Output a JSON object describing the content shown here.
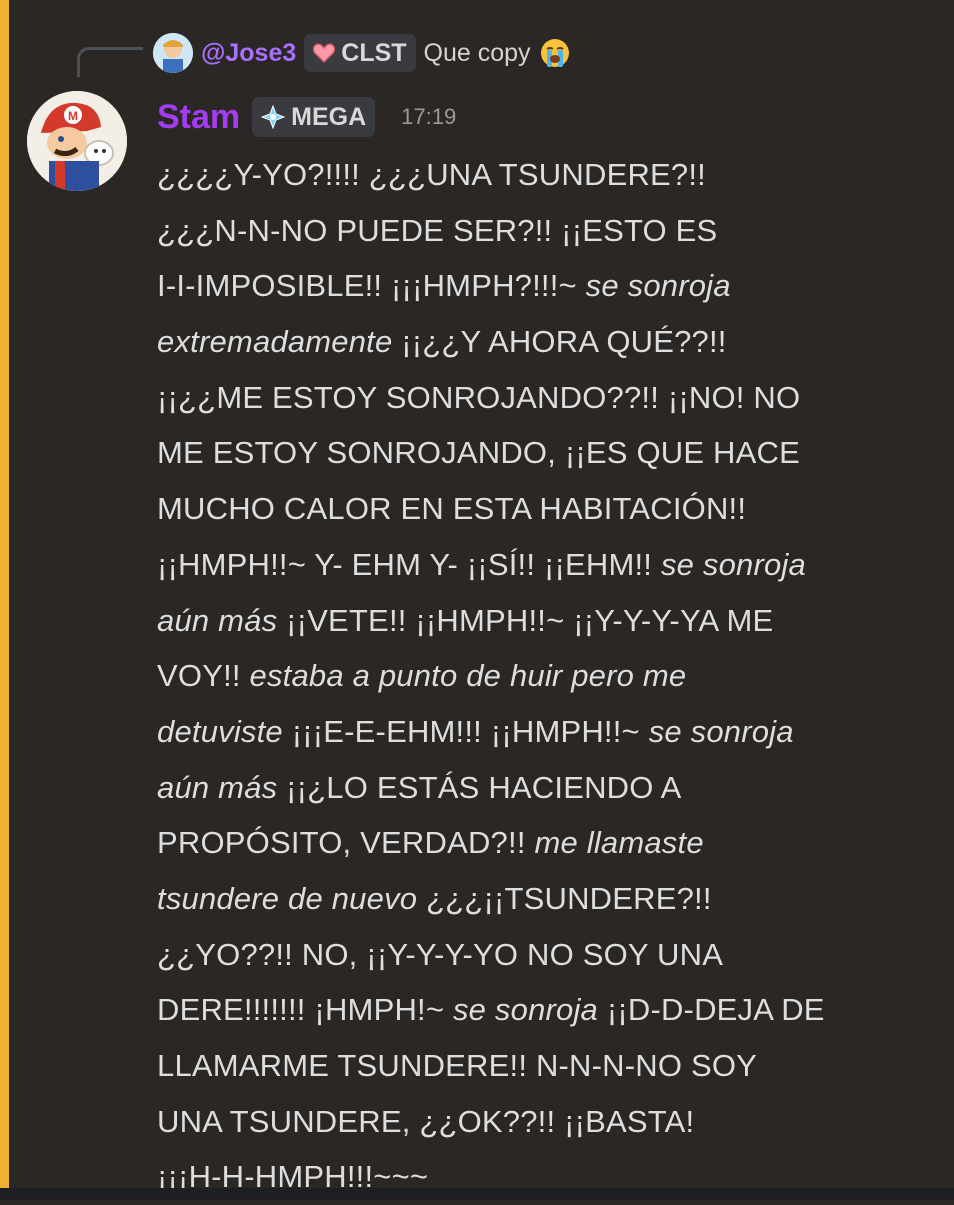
{
  "reply": {
    "username": "@Jose3",
    "tag_label": "CLST",
    "text": "Que copy",
    "emoji": "loudly-crying-face"
  },
  "message": {
    "author": "Stam",
    "role_tag": "MEGA",
    "timestamp": "17:19",
    "lines": [
      [
        {
          "t": "¿¿¿¿Y-YO?!!!! ¿¿¿UNA TSUNDERE?!!",
          "i": false
        }
      ],
      [
        {
          "t": "¿¿¿N-N-NO PUEDE SER?!! ¡¡ESTO ES",
          "i": false
        }
      ],
      [
        {
          "t": "I-I-IMPOSIBLE!! ¡¡¡HMPH?!!!~ ",
          "i": false
        },
        {
          "t": "se sonroja",
          "i": true
        }
      ],
      [
        {
          "t": "extremadamente",
          "i": true
        },
        {
          "t": " ¡¡¿¿Y AHORA QUÉ??!!",
          "i": false
        }
      ],
      [
        {
          "t": "¡¡¿¿ME ESTOY SONROJANDO??!! ¡¡NO! NO",
          "i": false
        }
      ],
      [
        {
          "t": "ME ESTOY SONROJANDO, ¡¡ES QUE HACE",
          "i": false
        }
      ],
      [
        {
          "t": "MUCHO CALOR EN ESTA HABITACIÓN!!",
          "i": false
        }
      ],
      [
        {
          "t": "¡¡HMPH!!~ Y- EHM Y- ¡¡SÍ!! ¡¡EHM!! ",
          "i": false
        },
        {
          "t": "se sonroja",
          "i": true
        }
      ],
      [
        {
          "t": "aún más",
          "i": true
        },
        {
          "t": " ¡¡VETE!! ¡¡HMPH!!~ ¡¡Y-Y-Y-YA ME",
          "i": false
        }
      ],
      [
        {
          "t": "VOY!! ",
          "i": false
        },
        {
          "t": "estaba a punto de huir pero me",
          "i": true
        }
      ],
      [
        {
          "t": "detuviste",
          "i": true
        },
        {
          "t": " ¡¡¡E-E-EHM!!! ¡¡HMPH!!~ ",
          "i": false
        },
        {
          "t": "se sonroja",
          "i": true
        }
      ],
      [
        {
          "t": "aún más",
          "i": true
        },
        {
          "t": " ¡¡¿LO ESTÁS HACIENDO A",
          "i": false
        }
      ],
      [
        {
          "t": "PROPÓSITO, VERDAD?!! ",
          "i": false
        },
        {
          "t": "me llamaste",
          "i": true
        }
      ],
      [
        {
          "t": "tsundere de nuevo",
          "i": true
        },
        {
          "t": " ¿¿¿¡¡TSUNDERE?!!",
          "i": false
        }
      ],
      [
        {
          "t": "¿¿YO??!! NO, ¡¡Y-Y-Y-YO NO SOY UNA",
          "i": false
        }
      ],
      [
        {
          "t": "DERE!!!!!!! ¡HMPH!~ ",
          "i": false
        },
        {
          "t": "se sonroja",
          "i": true
        },
        {
          "t": " ¡¡D-D-DEJA DE",
          "i": false
        }
      ],
      [
        {
          "t": "LLAMARME TSUNDERE!! N-N-N-NO SOY",
          "i": false
        }
      ],
      [
        {
          "t": "UNA TSUNDERE, ¿¿OK??!! ¡¡BASTA!",
          "i": false
        }
      ],
      [
        {
          "t": "¡¡¡H-H-HMPH!!!~~~",
          "i": false
        }
      ]
    ]
  },
  "colors": {
    "accent_bar": "#f0b232",
    "background": "#2a2724",
    "reply_username": "#a970ff",
    "author": "#a43cf3"
  }
}
